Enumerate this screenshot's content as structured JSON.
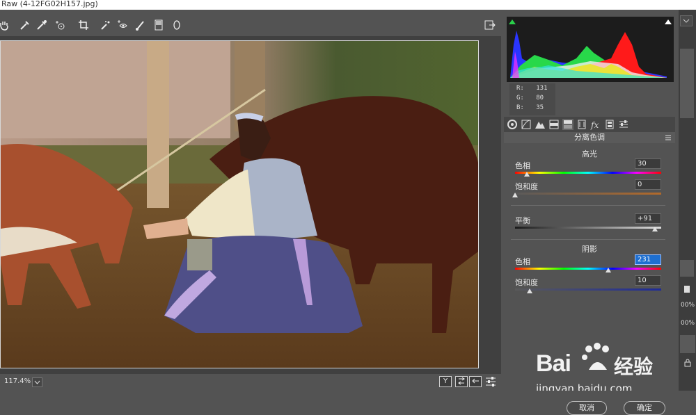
{
  "window": {
    "title": "Raw (4-12FG02H157.jpg)"
  },
  "toolbar": {
    "tools": [
      {
        "name": "hand-icon"
      },
      {
        "name": "eyedropper-icon"
      },
      {
        "name": "color-sampler-icon"
      },
      {
        "name": "target-adjust-icon"
      },
      {
        "name": "crop-icon"
      },
      {
        "name": "straighten-icon"
      },
      {
        "name": "spot-removal-icon"
      },
      {
        "name": "red-eye-icon"
      },
      {
        "name": "adjustment-brush-icon"
      },
      {
        "name": "graduated-filter-icon"
      },
      {
        "name": "radial-filter-icon"
      }
    ]
  },
  "status": {
    "zoom": "117.4%",
    "btn_y": "Y"
  },
  "info": {
    "r_label": "R:",
    "r": "131",
    "g_label": "G:",
    "g": "80",
    "b_label": "B:",
    "b": "35"
  },
  "panel": {
    "title": "分离色调",
    "highlights": {
      "heading": "高光",
      "hue_label": "色相",
      "hue": "30",
      "hue_pos": 0.08,
      "sat_label": "饱和度",
      "sat": "0",
      "sat_pos": 0.0
    },
    "balance": {
      "label": "平衡",
      "value": "+91",
      "pos": 0.955
    },
    "shadows": {
      "heading": "阴影",
      "hue_label": "色相",
      "hue": "231",
      "hue_pos": 0.64,
      "sat_label": "饱和度",
      "sat": "10",
      "sat_pos": 0.1
    }
  },
  "buttons": {
    "cancel": "取消",
    "ok": "确定"
  },
  "watermark": {
    "brand": "Bai",
    "brand2": "经验",
    "url": "jingyan.baidu.com"
  },
  "right_strip": {
    "pct1": "00%",
    "pct2": "00%"
  },
  "colors": {
    "bg": "#535353",
    "accent": "#1e6fd0"
  }
}
